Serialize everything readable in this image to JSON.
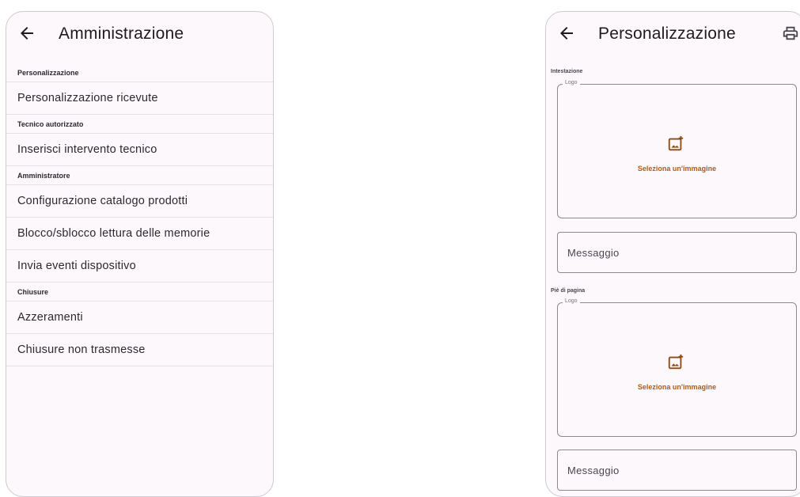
{
  "left": {
    "title": "Amministrazione",
    "sections": [
      {
        "header": "Personalizzazione",
        "items": [
          "Personalizzazione ricevute"
        ]
      },
      {
        "header": "Tecnico autorizzato",
        "items": [
          "Inserisci intervento tecnico"
        ]
      },
      {
        "header": "Amministratore",
        "items": [
          "Configurazione catalogo prodotti",
          "Blocco/sblocco lettura delle memorie",
          "Invia eventi dispositivo"
        ]
      },
      {
        "header": "Chiusure",
        "items": [
          "Azzeramenti",
          "Chiusure non trasmesse"
        ]
      }
    ]
  },
  "right": {
    "title": "Personalizzazione",
    "header_section": {
      "label": "Intestazione",
      "logo_legend": "Logo",
      "select_image": "Seleziona un'immagine",
      "message_placeholder": "Messaggio"
    },
    "footer_section": {
      "label": "Piè di pagina",
      "logo_legend": "Logo",
      "select_image": "Seleziona un'immagine",
      "message_placeholder": "Messaggio"
    }
  },
  "colors": {
    "accent": "#b05a15",
    "surface": "#fdf8fc",
    "border": "#8c8a90"
  }
}
